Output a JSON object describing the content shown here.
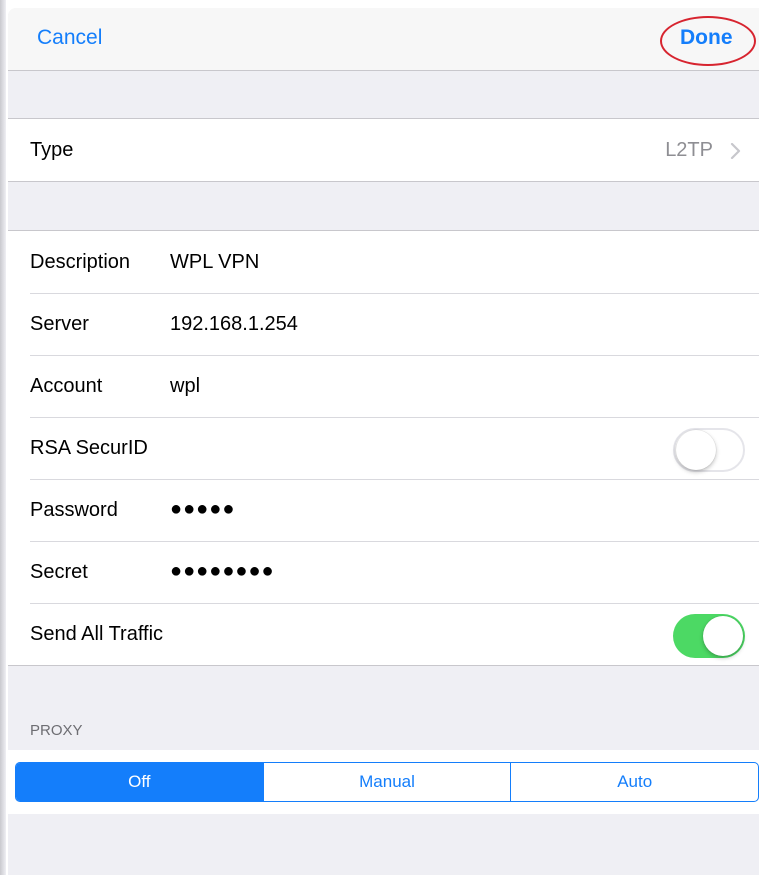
{
  "navbar": {
    "cancel_label": "Cancel",
    "done_label": "Done"
  },
  "type_row": {
    "label": "Type",
    "value": "L2TP"
  },
  "fields": {
    "description": {
      "label": "Description",
      "value": "WPL VPN"
    },
    "server": {
      "label": "Server",
      "value": "192.168.1.254"
    },
    "account": {
      "label": "Account",
      "value": "wpl"
    },
    "rsa": {
      "label": "RSA SecurID",
      "enabled": false
    },
    "password": {
      "label": "Password",
      "value": "●●●●●"
    },
    "secret": {
      "label": "Secret",
      "value": "●●●●●●●●"
    },
    "send_all": {
      "label": "Send All Traffic",
      "enabled": true
    }
  },
  "proxy": {
    "header": "PROXY",
    "options": [
      "Off",
      "Manual",
      "Auto"
    ],
    "selected": "Off"
  },
  "colors": {
    "accent": "#147efb",
    "switch_on": "#4cd964",
    "annotation": "#d7242f",
    "background": "#efeff4"
  }
}
